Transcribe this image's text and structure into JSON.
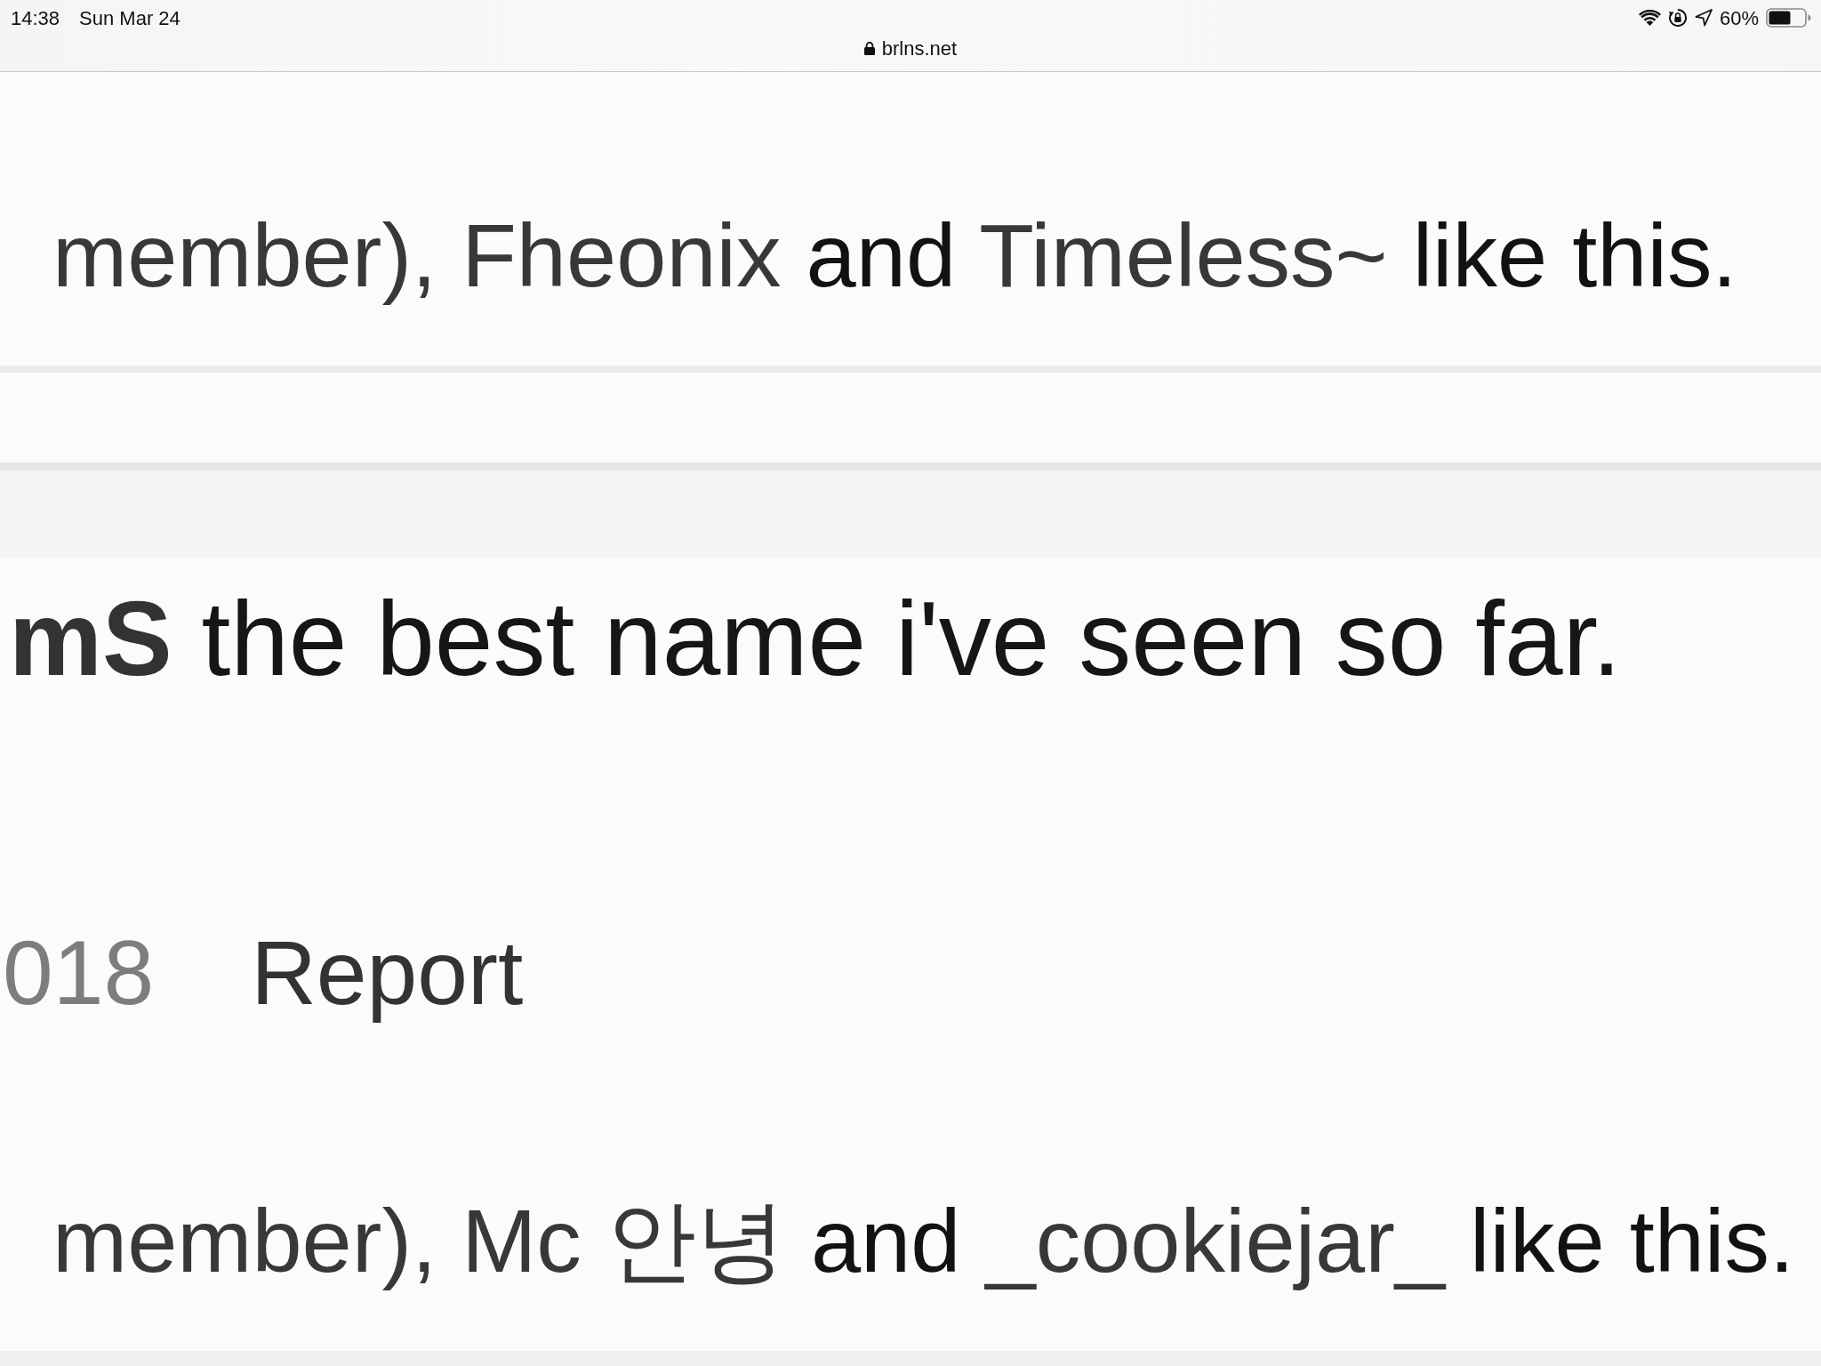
{
  "status_bar": {
    "time": "14:38",
    "date": "Sun Mar 24",
    "url": "brlns.net",
    "battery": "60%"
  },
  "previous_post": {
    "likes": [
      {
        "kind": "deleted",
        "text": "member), "
      },
      {
        "kind": "name",
        "text": "Fheonix"
      },
      {
        "kind": "text",
        "text": " and "
      },
      {
        "kind": "name",
        "text": "Timeless~"
      },
      {
        "kind": "text",
        "text": " like this."
      }
    ]
  },
  "post": {
    "message": "**mS** the best name i've seen so far.",
    "date": "018",
    "report": "Report",
    "likes": [
      {
        "kind": "deleted",
        "text": "member), "
      },
      {
        "kind": "name",
        "text": "Mc 안녕"
      },
      {
        "kind": "text",
        "text": " and "
      },
      {
        "kind": "name",
        "text": "_cookiejar_"
      },
      {
        "kind": "text",
        "text": " like this."
      }
    ]
  }
}
